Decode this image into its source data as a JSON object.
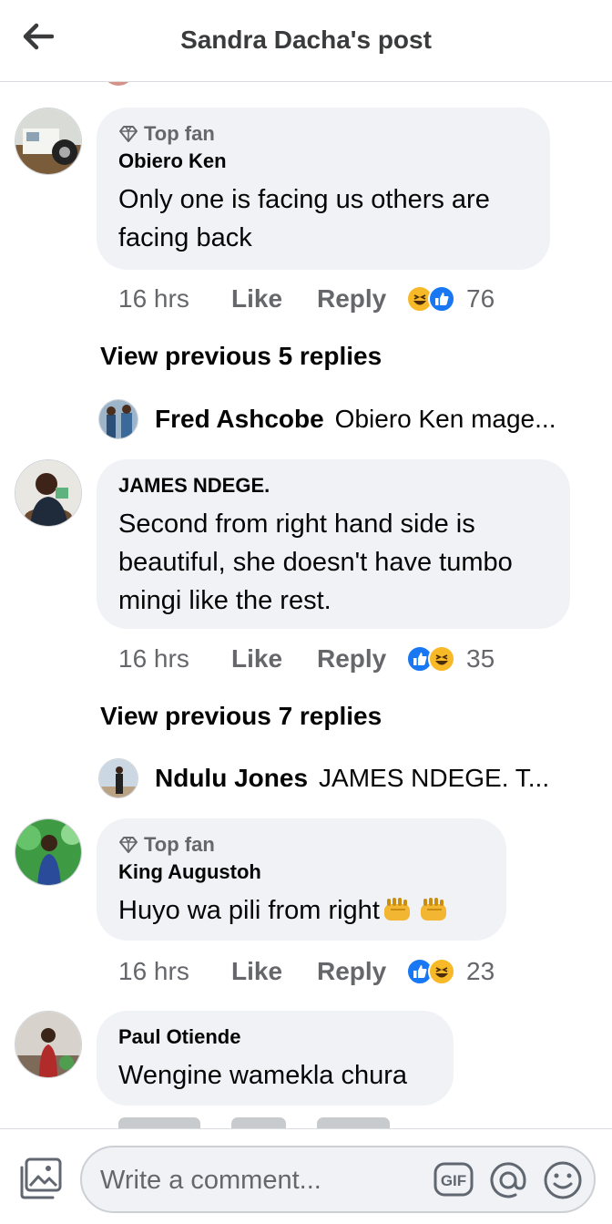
{
  "header": {
    "title": "Sandra Dacha's post",
    "back_icon": "arrow-left-icon"
  },
  "colors": {
    "bubble_bg": "#f0f2f5",
    "meta_text": "#65676b",
    "like_blue": "#1877f2",
    "haha_yellow": "#f7b928",
    "divider": "#dadde1"
  },
  "comments": [
    {
      "badge": "Top fan",
      "author": "Obiero Ken",
      "text": "Only  one is facing us others are facing back",
      "time": "16 hrs",
      "like": "Like",
      "reply": "Reply",
      "reactions": [
        "haha",
        "like"
      ],
      "reaction_count": "76",
      "view_previous": "View previous 5 replies",
      "latest_reply": {
        "author": "Fred Ashcobe",
        "text": "Obiero Ken mage..."
      }
    },
    {
      "author": "JAMES NDEGE.",
      "text": "Second from right hand side is beautiful, she doesn't have tumbo mingi like the rest.",
      "time": "16 hrs",
      "like": "Like",
      "reply": "Reply",
      "reactions": [
        "like",
        "haha"
      ],
      "reaction_count": "35",
      "view_previous": "View previous 7 replies",
      "latest_reply": {
        "author": "Ndulu Jones",
        "text": "JAMES NDEGE. T..."
      }
    },
    {
      "badge": "Top fan",
      "author": "King Augustoh",
      "text": "Huyo wa pili from right",
      "time": "16 hrs",
      "like": "Like",
      "reply": "Reply",
      "reactions": [
        "like",
        "haha"
      ],
      "reaction_count": "23"
    },
    {
      "author": "Paul Otiende",
      "text": "Wengine wamekla chura"
    }
  ],
  "composer": {
    "placeholder": "Write a comment...",
    "gif_label": "GIF",
    "icons": [
      "photo-icon",
      "gif-icon",
      "at-sign-icon",
      "emoji-icon"
    ]
  }
}
